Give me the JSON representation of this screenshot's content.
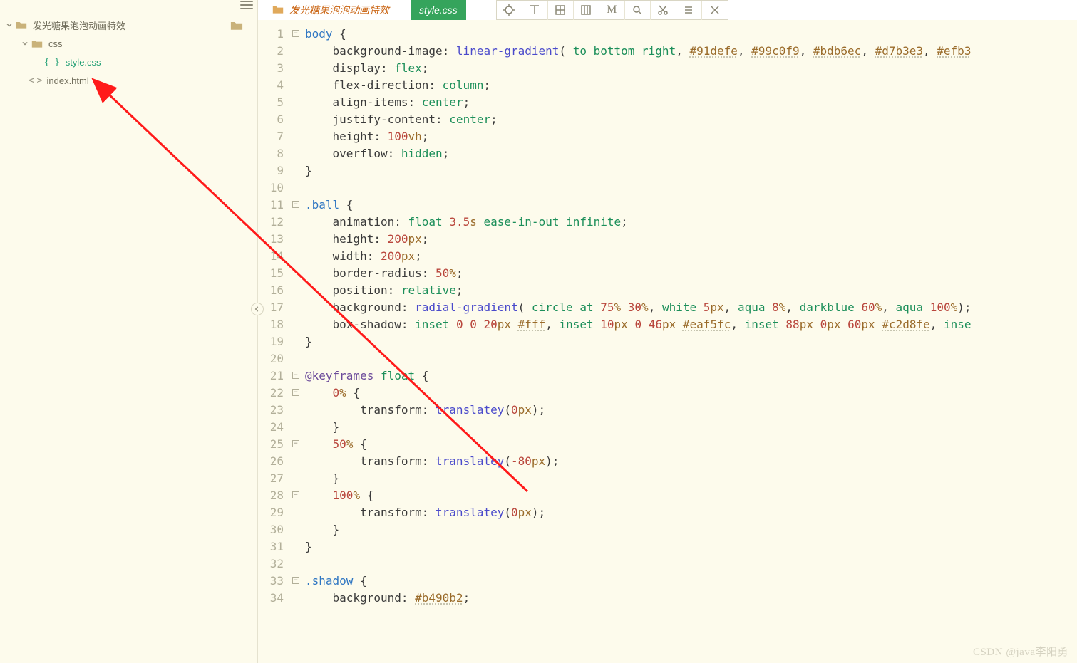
{
  "project": {
    "name": "发光糖果泡泡动画特效",
    "folders": [
      {
        "name": "css",
        "files": [
          {
            "name": "style.css",
            "active": true
          }
        ]
      }
    ],
    "rootFiles": [
      {
        "name": "index.html"
      }
    ]
  },
  "tabs": {
    "folderTab": "发光糖果泡泡动画特效",
    "activeTab": "style.css"
  },
  "toolbar": {
    "icons": [
      "crosshair",
      "align-top",
      "grid-4",
      "columns-3",
      "letter-M",
      "search",
      "scissors",
      "list",
      "close"
    ]
  },
  "watermark": "CSDN @java李阳勇",
  "code": {
    "lines": [
      {
        "n": 1,
        "fold": "open",
        "html": "<span class='sel'>body</span> {"
      },
      {
        "n": 2,
        "html": "    <span class='prop'>background-image</span>: <span class='func'>linear-gradient</span>( <span class='ident'>to</span> <span class='ident'>bottom</span> <span class='ident'>right</span>, <span class='hex'>#91defe</span>, <span class='hex'>#99c0f9</span>, <span class='hex'>#bdb6ec</span>, <span class='hex'>#d7b3e3</span>, <span class='hex'>#efb3</span>"
      },
      {
        "n": 3,
        "html": "    <span class='prop'>display</span>: <span class='ident'>flex</span>;"
      },
      {
        "n": 4,
        "html": "    <span class='prop'>flex-direction</span>: <span class='ident'>column</span>;"
      },
      {
        "n": 5,
        "html": "    <span class='prop'>align-items</span>: <span class='ident'>center</span>;"
      },
      {
        "n": 6,
        "html": "    <span class='prop'>justify-content</span>: <span class='ident'>center</span>;"
      },
      {
        "n": 7,
        "html": "    <span class='prop'>height</span>: <span class='num'>100</span><span class='unit'>vh</span>;"
      },
      {
        "n": 8,
        "html": "    <span class='prop'>overflow</span>: <span class='ident'>hidden</span>;"
      },
      {
        "n": 9,
        "html": "}"
      },
      {
        "n": 10,
        "html": ""
      },
      {
        "n": 11,
        "fold": "open",
        "html": "<span class='sel'>.ball</span> {"
      },
      {
        "n": 12,
        "html": "    <span class='prop'>animation</span>: <span class='ident'>float</span> <span class='num'>3.5</span><span class='unit'>s</span> <span class='ident'>ease-in-out</span> <span class='ident'>infinite</span>;"
      },
      {
        "n": 13,
        "html": "    <span class='prop'>height</span>: <span class='num'>200</span><span class='unit'>px</span>;"
      },
      {
        "n": 14,
        "html": "    <span class='prop'>width</span>: <span class='num'>200</span><span class='unit'>px</span>;"
      },
      {
        "n": 15,
        "html": "    <span class='prop'>border-radius</span>: <span class='num'>50</span><span class='unit'>%</span>;"
      },
      {
        "n": 16,
        "html": "    <span class='prop'>position</span>: <span class='ident'>relative</span>;"
      },
      {
        "n": 17,
        "html": "    <span class='prop'>background</span>: <span class='func'>radial-gradient</span>( <span class='ident'>circle</span> <span class='ident'>at</span> <span class='num'>75</span><span class='unit'>%</span> <span class='num'>30</span><span class='unit'>%</span>, <span class='ident'>white</span> <span class='num'>5</span><span class='unit'>px</span>, <span class='ident'>aqua</span> <span class='num'>8</span><span class='unit'>%</span>, <span class='ident'>darkblue</span> <span class='num'>60</span><span class='unit'>%</span>, <span class='ident'>aqua</span> <span class='num'>100</span><span class='unit'>%</span>);"
      },
      {
        "n": 18,
        "html": "    <span class='prop'>box-shadow</span>: <span class='ident'>inset</span> <span class='num'>0</span> <span class='num'>0</span> <span class='num'>20</span><span class='unit'>px</span> <span class='hex'>#fff</span>, <span class='ident'>inset</span> <span class='num'>10</span><span class='unit'>px</span> <span class='num'>0</span> <span class='num'>46</span><span class='unit'>px</span> <span class='hex'>#eaf5fc</span>, <span class='ident'>inset</span> <span class='num'>88</span><span class='unit'>px</span> <span class='num'>0</span><span class='unit'>px</span> <span class='num'>60</span><span class='unit'>px</span> <span class='hex'>#c2d8fe</span>, <span class='ident'>inse</span>"
      },
      {
        "n": 19,
        "html": "}"
      },
      {
        "n": 20,
        "html": ""
      },
      {
        "n": 21,
        "fold": "open",
        "html": "<span class='at'>@keyframes</span> <span class='ident'>float</span> {"
      },
      {
        "n": 22,
        "fold": "open",
        "html": "    <span class='num'>0</span><span class='unit'>%</span> {"
      },
      {
        "n": 23,
        "html": "        <span class='prop'>transform</span>: <span class='func'>translatey</span>(<span class='num'>0</span><span class='unit'>px</span>);"
      },
      {
        "n": 24,
        "html": "    }"
      },
      {
        "n": 25,
        "fold": "open",
        "html": "    <span class='num'>50</span><span class='unit'>%</span> {"
      },
      {
        "n": 26,
        "html": "        <span class='prop'>transform</span>: <span class='func'>translatey</span>(<span class='num'>-80</span><span class='unit'>px</span>);"
      },
      {
        "n": 27,
        "html": "    }"
      },
      {
        "n": 28,
        "fold": "open",
        "html": "    <span class='num'>100</span><span class='unit'>%</span> {"
      },
      {
        "n": 29,
        "html": "        <span class='prop'>transform</span>: <span class='func'>translatey</span>(<span class='num'>0</span><span class='unit'>px</span>);"
      },
      {
        "n": 30,
        "html": "    }"
      },
      {
        "n": 31,
        "html": "}"
      },
      {
        "n": 32,
        "html": ""
      },
      {
        "n": 33,
        "fold": "open",
        "html": "<span class='sel'>.shadow</span> {"
      },
      {
        "n": 34,
        "html": "    <span class='prop'>background</span>: <span class='hex'>#b490b2</span>;"
      }
    ]
  }
}
